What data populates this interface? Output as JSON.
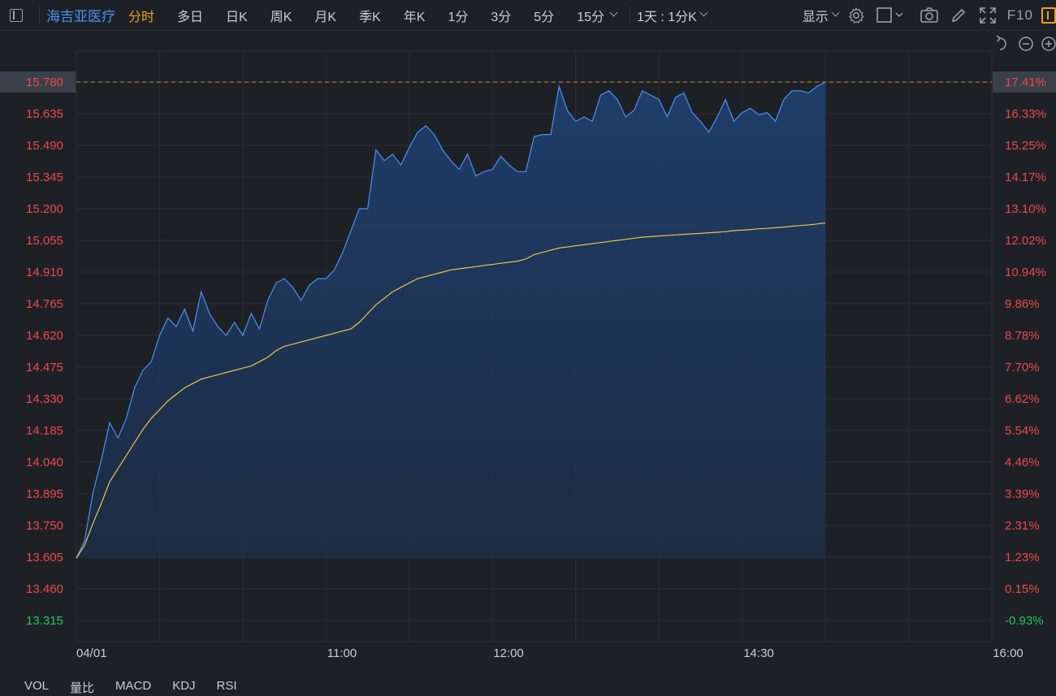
{
  "toolbar": {
    "stock_name": "海吉亚医疗",
    "periods": [
      "分时",
      "多日",
      "日K",
      "周K",
      "月K",
      "季K",
      "年K",
      "1分",
      "3分",
      "5分",
      "15分"
    ],
    "active_period": "分时",
    "interval_label": "1天 : 1分K",
    "display_label": "显示",
    "f10_label": "F10"
  },
  "chart_controls": [
    "undo-icon",
    "zoom-out-icon",
    "zoom-in-icon"
  ],
  "colors": {
    "price_line": "#4c8ff5",
    "avg_line": "#f0c24a",
    "up": "#f04848",
    "down": "#22c55e",
    "highlight": "#f0a022"
  },
  "chart_data": {
    "type": "line",
    "title": "",
    "x_ticks": [
      "04/01",
      "11:00",
      "12:00",
      "14:30",
      "16:00"
    ],
    "y_left_ticks": [
      "15.780",
      "15.635",
      "15.490",
      "15.345",
      "15.200",
      "15.055",
      "14.910",
      "14.765",
      "14.620",
      "14.475",
      "14.330",
      "14.185",
      "14.040",
      "13.895",
      "13.750",
      "13.605",
      "13.460",
      "13.315"
    ],
    "y_right_ticks": [
      "17.41%",
      "16.33%",
      "15.25%",
      "14.17%",
      "13.10%",
      "12.02%",
      "10.94%",
      "9.86%",
      "8.78%",
      "7.70%",
      "6.62%",
      "5.54%",
      "4.46%",
      "3.39%",
      "2.31%",
      "1.23%",
      "0.15%",
      "-0.93%"
    ],
    "ylim": [
      13.315,
      15.78
    ],
    "prev_close": 13.44,
    "current_price_label": "15.780",
    "current_pct_label": "17.41%",
    "session_minutes": 330,
    "series": [
      {
        "name": "",
        "values": [
          13.6,
          13.68,
          13.9,
          14.05,
          14.22,
          14.15,
          14.24,
          14.38,
          14.46,
          14.5,
          14.62,
          14.7,
          14.66,
          14.74,
          14.64,
          14.82,
          14.72,
          14.66,
          14.62,
          14.68,
          14.62,
          14.72,
          14.65,
          14.78,
          14.86,
          14.88,
          14.84,
          14.78,
          14.85,
          14.88,
          14.88,
          14.92,
          15.0,
          15.1,
          15.2,
          15.2,
          15.47,
          15.42,
          15.45,
          15.4,
          15.48,
          15.55,
          15.58,
          15.54,
          15.47,
          15.42,
          15.38,
          15.45,
          15.35,
          15.37,
          15.38,
          15.44,
          15.4,
          15.37,
          15.37,
          15.53,
          15.54,
          15.54,
          15.76,
          15.65,
          15.6,
          15.62,
          15.6,
          15.72,
          15.74,
          15.7,
          15.62,
          15.65,
          15.74,
          15.72,
          15.7,
          15.62,
          15.71,
          15.73,
          15.64,
          15.6,
          15.55,
          15.62,
          15.7,
          15.6,
          15.64,
          15.66,
          15.63,
          15.64,
          15.6,
          15.7,
          15.74,
          15.74,
          15.73,
          15.76,
          15.78
        ]
      },
      {
        "name": "",
        "values": [
          13.6,
          13.66,
          13.76,
          13.85,
          13.95,
          14.01,
          14.07,
          14.13,
          14.19,
          14.24,
          14.28,
          14.32,
          14.35,
          14.38,
          14.4,
          14.42,
          14.43,
          14.44,
          14.45,
          14.46,
          14.47,
          14.48,
          14.5,
          14.52,
          14.55,
          14.57,
          14.58,
          14.59,
          14.6,
          14.61,
          14.62,
          14.63,
          14.64,
          14.65,
          14.68,
          14.72,
          14.76,
          14.79,
          14.82,
          14.84,
          14.86,
          14.88,
          14.89,
          14.9,
          14.91,
          14.92,
          14.925,
          14.93,
          14.935,
          14.94,
          14.945,
          14.95,
          14.955,
          14.96,
          14.97,
          14.99,
          15.0,
          15.01,
          15.02,
          15.025,
          15.03,
          15.035,
          15.04,
          15.045,
          15.05,
          15.055,
          15.06,
          15.065,
          15.07,
          15.072,
          15.075,
          15.078,
          15.08,
          15.083,
          15.085,
          15.087,
          15.09,
          15.092,
          15.095,
          15.1,
          15.102,
          15.105,
          15.108,
          15.11,
          15.113,
          15.116,
          15.12,
          15.123,
          15.126,
          15.13,
          15.135
        ]
      }
    ]
  },
  "bottom_tabs": [
    "VOL",
    "量比",
    "MACD",
    "KDJ",
    "RSI"
  ]
}
